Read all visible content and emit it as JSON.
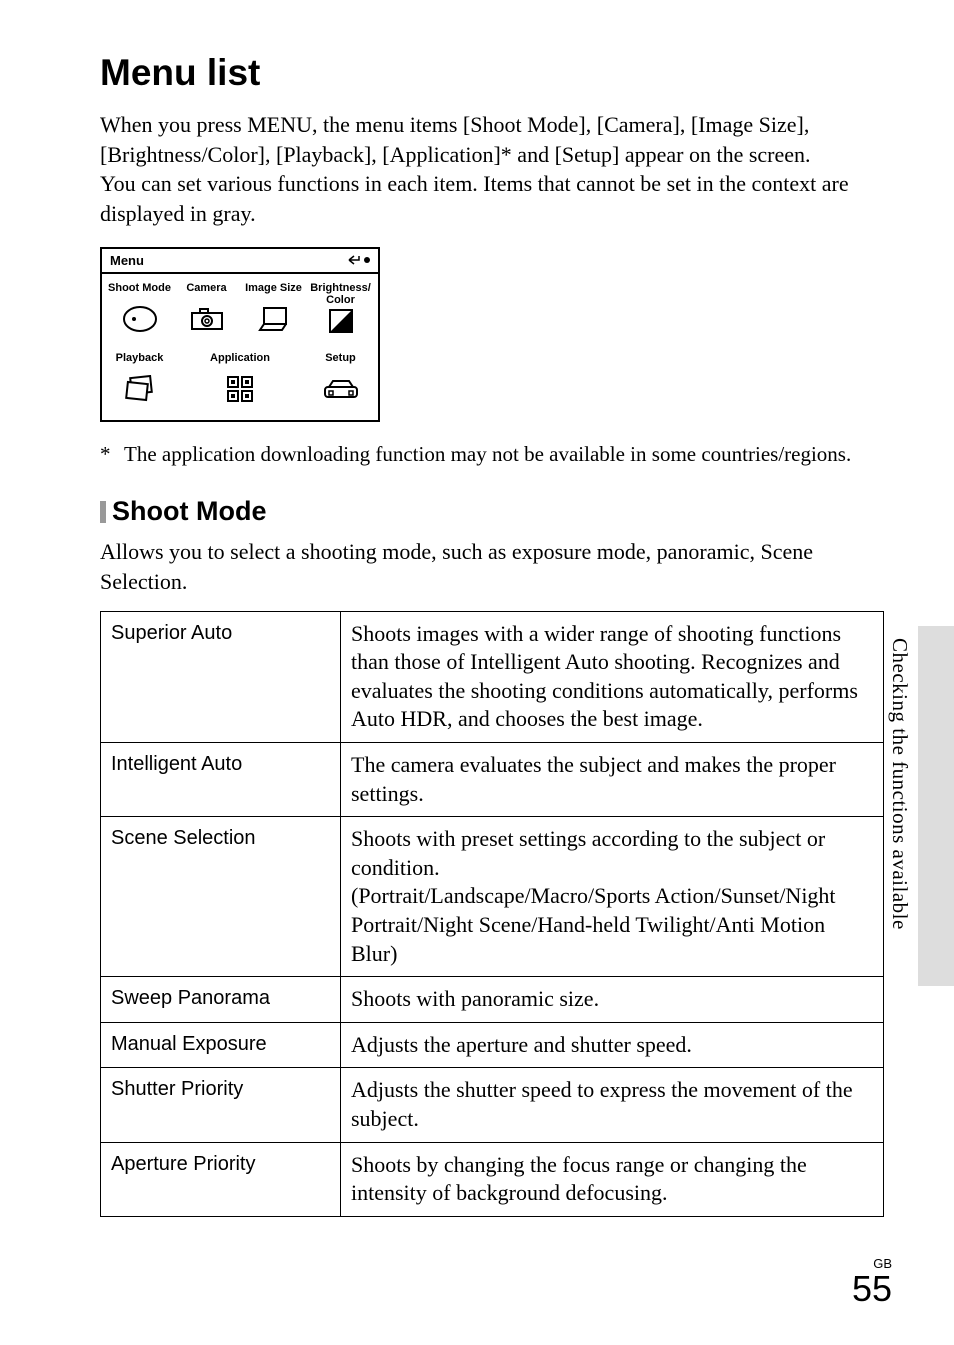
{
  "title": "Menu list",
  "intro": "When you press MENU, the menu items [Shoot Mode], [Camera], [Image Size], [Brightness/Color], [Playback], [Application]* and [Setup] appear on the screen.\nYou can set various functions in each item. Items that cannot be set in the context are displayed in gray.",
  "diagram": {
    "menu_label": "Menu",
    "items": [
      "Shoot Mode",
      "Camera",
      "Image Size",
      "Brightness/\nColor",
      "Playback",
      "Application",
      "Setup"
    ]
  },
  "footnote": {
    "marker": "*",
    "text": "The application downloading function may not be available in some countries/regions."
  },
  "section": {
    "title": "Shoot Mode",
    "text": "Allows you to select a shooting mode, such as exposure mode, panoramic, Scene Selection."
  },
  "table": [
    {
      "label": "Superior Auto",
      "desc": "Shoots images with a wider range of shooting functions than those of Intelligent Auto shooting. Recognizes and evaluates the shooting conditions automatically, performs Auto HDR, and chooses the best image."
    },
    {
      "label": "Intelligent Auto",
      "desc": "The camera evaluates the subject and makes the proper settings."
    },
    {
      "label": "Scene Selection",
      "desc": "Shoots with preset settings according to the subject or condition.\n(Portrait/Landscape/Macro/Sports Action/Sunset/Night Portrait/Night Scene/Hand-held Twilight/Anti Motion Blur)"
    },
    {
      "label": "Sweep Panorama",
      "desc": "Shoots with panoramic size."
    },
    {
      "label": "Manual Exposure",
      "desc": "Adjusts the aperture and shutter speed."
    },
    {
      "label": "Shutter Priority",
      "desc": "Adjusts the shutter speed to express the movement of the subject."
    },
    {
      "label": "Aperture Priority",
      "desc": "Shoots by changing the focus range or changing the intensity of background defocusing."
    }
  ],
  "side_text": "Checking the functions available",
  "footer": {
    "region": "GB",
    "page": "55"
  }
}
